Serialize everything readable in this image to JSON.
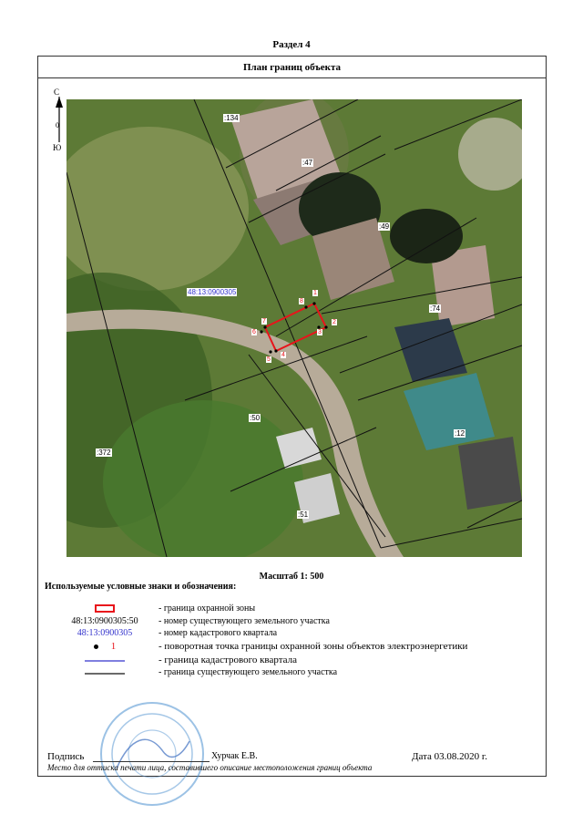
{
  "section_title": "Раздел 4",
  "frame_title": "План границ объекта",
  "compass": {
    "north": "С",
    "south": "Ю"
  },
  "map": {
    "parcel_labels": [
      ":134",
      ":47",
      ":49",
      ":74",
      ":12",
      ":50",
      ":372",
      ":51"
    ],
    "quarter_label": "48:13:0900305",
    "point_labels": [
      "1",
      "2",
      "3",
      "4",
      "5",
      "6",
      "7",
      "8"
    ],
    "colors": {
      "boundary": "#e8141b",
      "quarter": "#3333cc",
      "parcel": "#111111"
    }
  },
  "scale": "Масштаб 1: 500",
  "legend": {
    "title": "Используемые условные знаки и обозначения:",
    "items": [
      {
        "symbol": "",
        "desc": "- граница  охранной зоны"
      },
      {
        "symbol": "48:13:0900305:50",
        "desc": "- номер существующего земельного участка"
      },
      {
        "symbol": "48:13:0900305",
        "desc": "- номер кадастрового квартала"
      },
      {
        "symbol": "1",
        "desc": "- поворотная точка границы охранной зоны объектов электроэнергетики"
      },
      {
        "symbol": "",
        "desc": "- граница кадастрового квартала"
      },
      {
        "symbol": "",
        "desc": "- граница существующего земельного участка"
      }
    ]
  },
  "signature": {
    "label": "Подпись",
    "name": "Хурчак Е.В.",
    "date": "Дата 03.08.2020 г.",
    "note": "Место для оттиска печати лица, составившего описание местоположения границ объекта"
  }
}
